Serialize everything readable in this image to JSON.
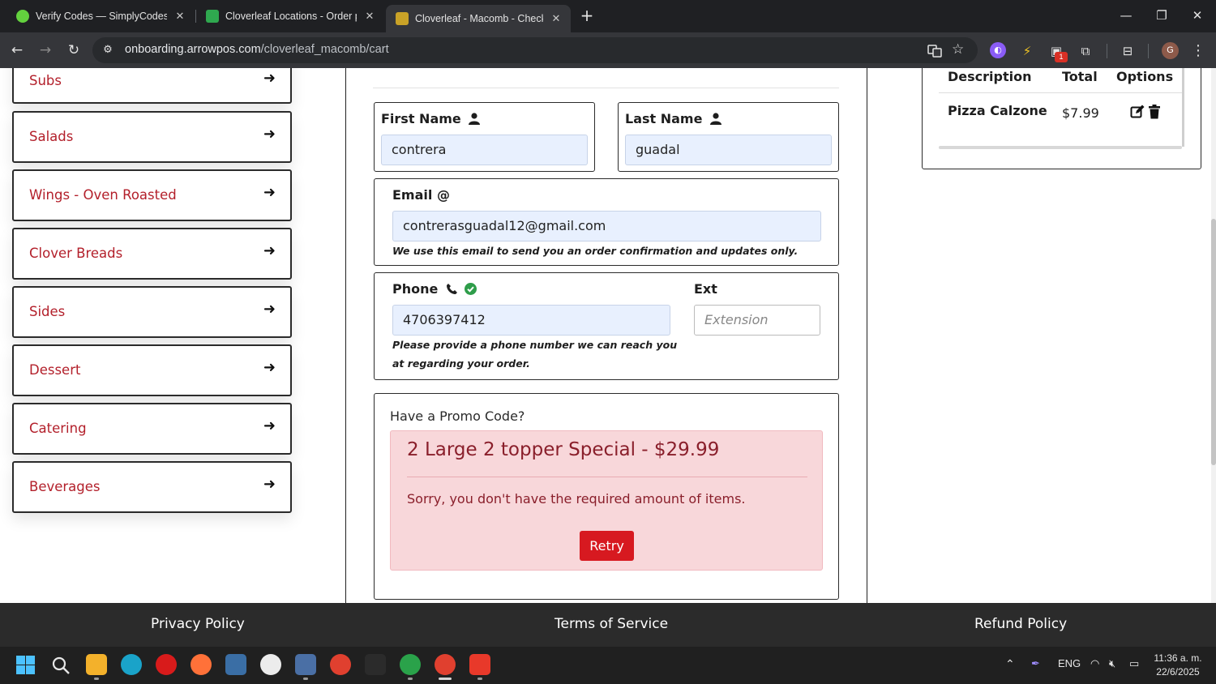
{
  "browser": {
    "tabs": [
      {
        "title": "Verify Codes — SimplyCodes",
        "favicon_color": "#63d13e"
      },
      {
        "title": "Cloverleaf Locations - Order piz",
        "favicon_color": "#2fa84f"
      },
      {
        "title": "Cloverleaf - Macomb - Checkou",
        "favicon_color": "#c9a227"
      }
    ],
    "url_host": "onboarding.arrowpos.com",
    "url_path": "/cloverleaf_macomb/cart",
    "profile_initial": "G",
    "extension_badge": "1"
  },
  "menu": {
    "items": [
      "Subs",
      "Salads",
      "Wings - Oven Roasted",
      "Clover Breads",
      "Sides",
      "Dessert",
      "Catering",
      "Beverages"
    ]
  },
  "checkout": {
    "first_name_label": "First Name",
    "first_name_value": "contrera",
    "last_name_label": "Last Name",
    "last_name_value": "guadal",
    "email_label": "Email @",
    "email_value": "contrerasguadal12@gmail.com",
    "email_help": "We use this email to send you an order confirmation and updates only.",
    "phone_label": "Phone",
    "phone_value": "4706397412",
    "phone_help_line1": "Please provide a phone number we can reach you",
    "phone_help_line2": "at regarding your order.",
    "ext_label": "Ext",
    "ext_placeholder": "Extension"
  },
  "promo": {
    "title": "Have a Promo Code?",
    "alert_heading": "2 Large 2 topper Special - $29.99",
    "alert_message": "Sorry, you don't have the required amount of items.",
    "retry_label": "Retry"
  },
  "cart": {
    "headers": [
      "Description",
      "Total",
      "Options"
    ],
    "items": [
      {
        "description": "Pizza Calzone",
        "total": "$7.99"
      }
    ]
  },
  "footer": {
    "links": [
      "Privacy Policy",
      "Terms of Service",
      "Refund Policy"
    ]
  },
  "taskbar": {
    "language": "ENG",
    "time": "11:36 a. m.",
    "date": "22/6/2025"
  },
  "colors": {
    "brand_red": "#b3202b",
    "alert_bg": "#f8d7da",
    "retry_bg": "#d71920",
    "input_bg": "#e8f0fe",
    "footer_bg": "#2b2b2b"
  }
}
